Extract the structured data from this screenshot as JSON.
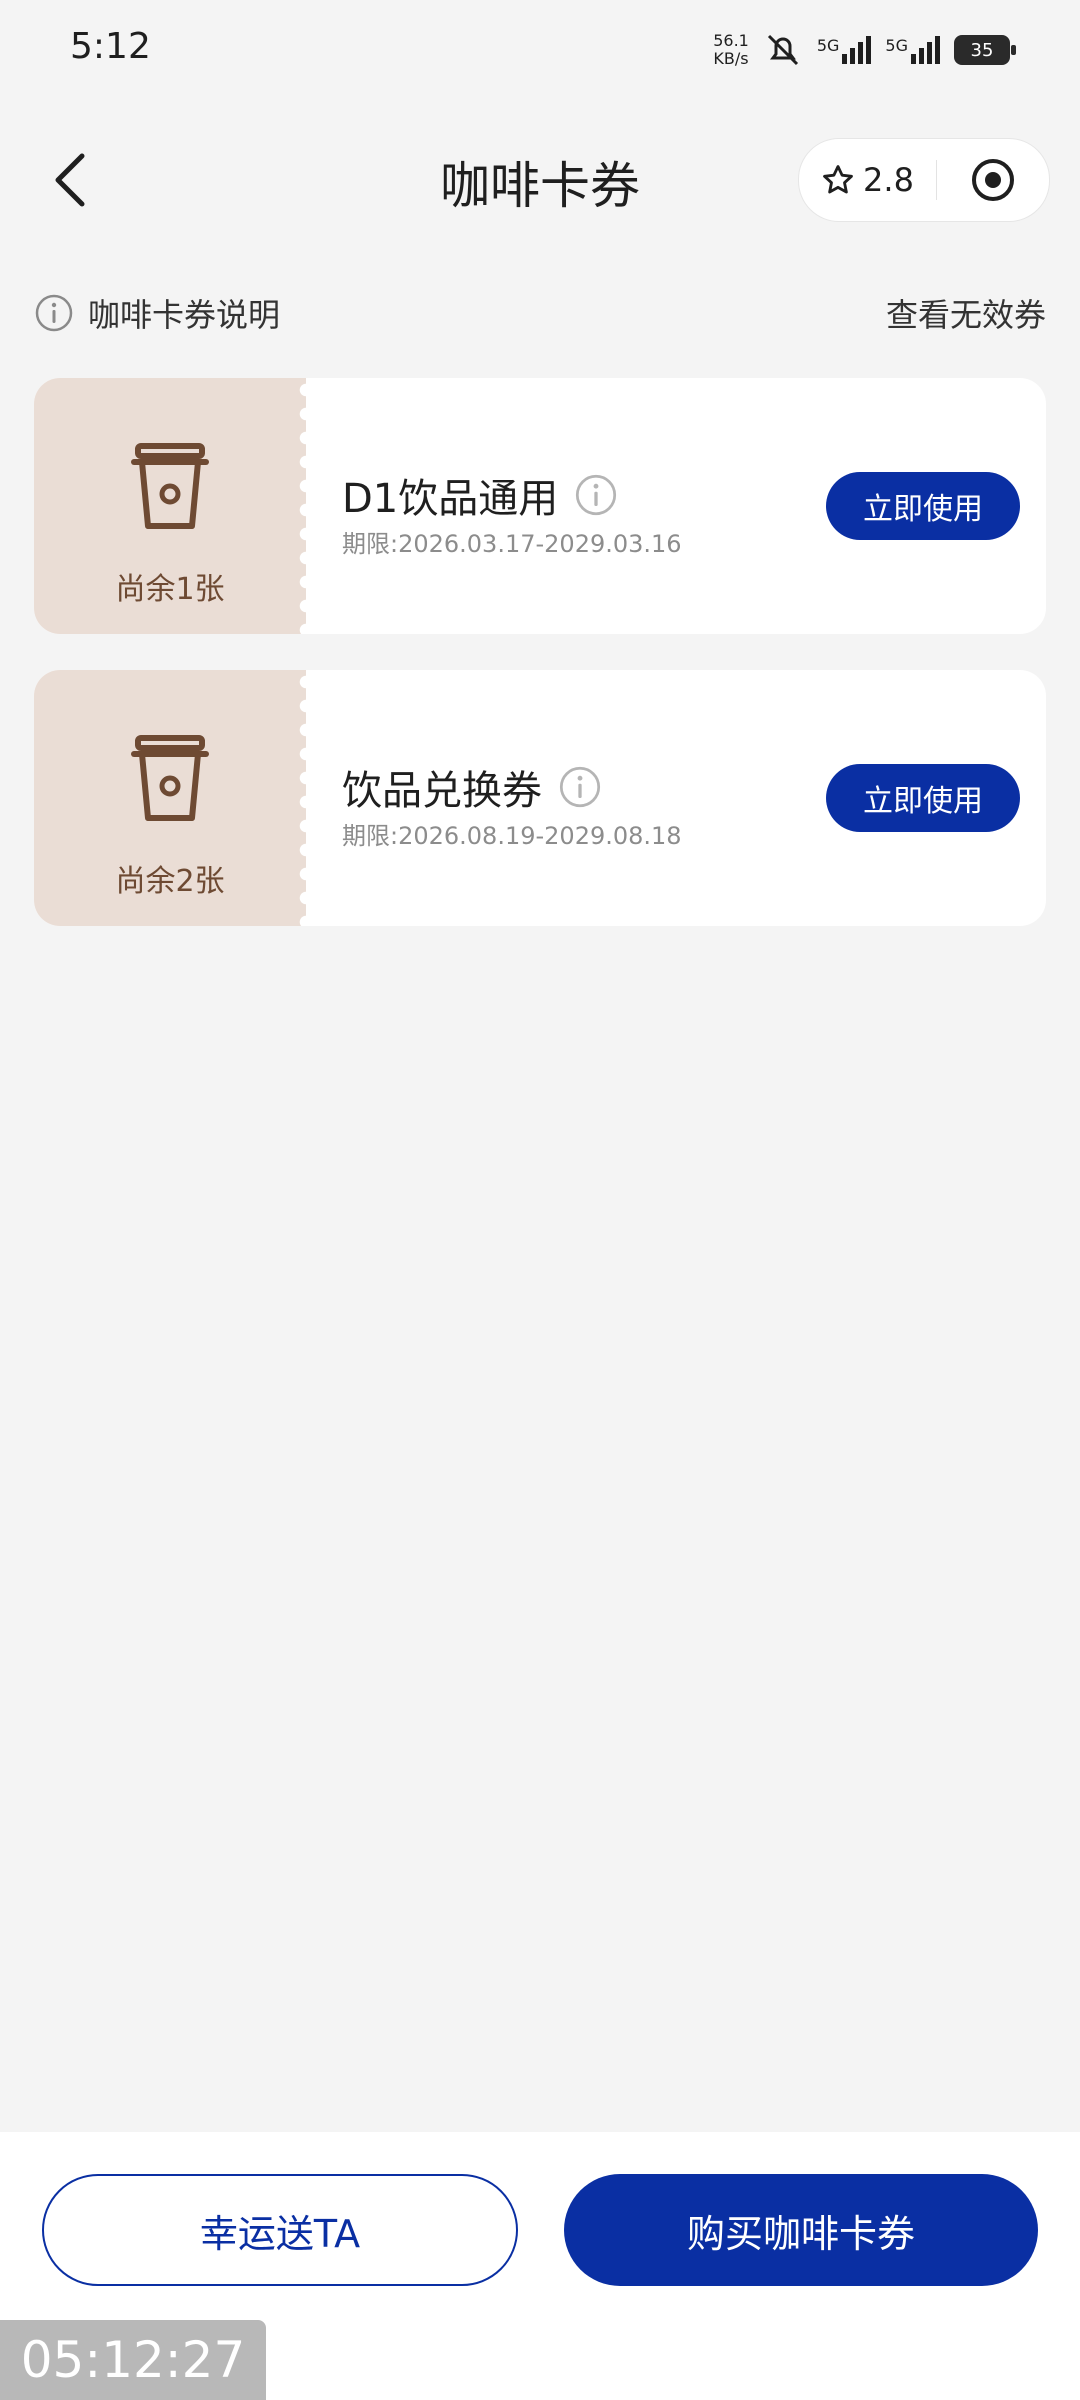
{
  "status_bar": {
    "time": "5:12",
    "net_speed_value": "56.1",
    "net_speed_unit": "KB/s",
    "network1": "5G",
    "network2": "5G",
    "battery": "35"
  },
  "header": {
    "title": "咖啡卡券",
    "rating": "2.8"
  },
  "info": {
    "explain_label": "咖啡卡券说明",
    "invalid_label": "查看无效券"
  },
  "coupons": [
    {
      "name": "D1饮品通用",
      "validity": "期限:2026.03.17-2029.03.16",
      "remaining": "尚余1张",
      "button": "立即使用"
    },
    {
      "name": "饮品兑换券",
      "validity": "期限:2026.08.19-2029.08.18",
      "remaining": "尚余2张",
      "button": "立即使用"
    }
  ],
  "bottom": {
    "gift_label": "幸运送TA",
    "buy_label": "购买咖啡卡券"
  },
  "overlay_time": "05:12:27",
  "colors": {
    "accent": "#0a2fa3",
    "coupon_left_bg": "#eaddd5",
    "coupon_icon": "#6e4a33",
    "page_bg": "#f4f4f4"
  }
}
